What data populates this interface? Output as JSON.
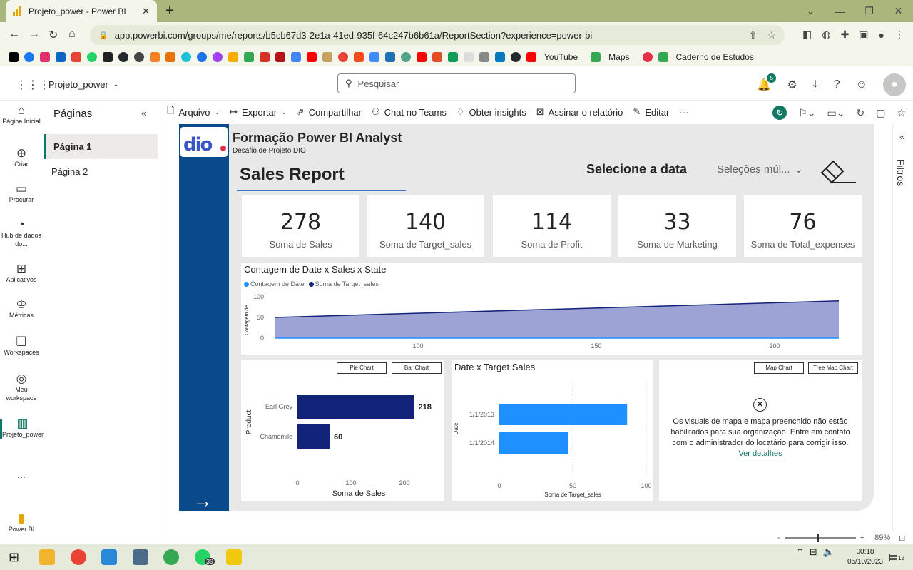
{
  "browser": {
    "tab_title": "Projeto_power - Power BI",
    "tab_close": "✕",
    "new_tab": "+",
    "url": "app.powerbi.com/groups/me/reports/b5cb67d3-2e1a-41ed-935f-64c247b6b61a/ReportSection?experience=power-bi",
    "bookmarks": [
      "YouTube",
      "Maps",
      "Caderno de Estudos"
    ]
  },
  "header": {
    "workspace": "Projeto_power",
    "search_placeholder": "Pesquisar",
    "notification_count": "5"
  },
  "rail": {
    "items": [
      "Página Inicial",
      "Criar",
      "Procurar",
      "Hub de dados do...",
      "Aplicativos",
      "Métricas",
      "Workspaces",
      "Meu workspace",
      "Projeto_power"
    ],
    "more": "...",
    "app_label": "Power BI"
  },
  "pages_pane": {
    "title": "Páginas",
    "pages": [
      "Página 1",
      "Página 2"
    ]
  },
  "toolbar": {
    "arquivo": "Arquivo",
    "exportar": "Exportar",
    "compartilhar": "Compartilhar",
    "chat": "Chat no Teams",
    "insights": "Obter insights",
    "assinar": "Assinar o relatório",
    "editar": "Editar",
    "more": "···"
  },
  "report": {
    "title": "Formação Power BI Analyst",
    "subtitle": "Desafio de Projeto DIO",
    "heading": "Sales Report",
    "date_label": "Selecione a data",
    "slicer_value": "Seleções múl...",
    "kpis": [
      {
        "value": "278",
        "label": "Soma de Sales"
      },
      {
        "value": "140",
        "label": "Soma de Target_sales"
      },
      {
        "value": "114",
        "label": "Soma de Profit"
      },
      {
        "value": "33",
        "label": "Soma de Marketing"
      },
      {
        "value": "76",
        "label": "Soma de Total_expenses"
      }
    ],
    "area_chart_title": "Contagem de Date x Sales x State",
    "buttons": {
      "pie": "Pie Chart",
      "bar": "Bar Chart",
      "map": "Map Chart",
      "treemap": "Tree Map Chart"
    },
    "date_target_title": "Date x Target Sales",
    "map_message": "Os visuais de mapa e mapa preenchido não estão habilitados para sua organização. Entre em contato com o administrador do locatário para corrigir isso.",
    "map_link": "Ver detalhes"
  },
  "filters": {
    "label": "Filtros"
  },
  "zoom": {
    "value": "89%"
  },
  "taskbar": {
    "time": "00:18",
    "date": "05/10/2023",
    "whatsapp_badge": "39",
    "notif_count": "12"
  },
  "colors": {
    "accent": "#117865",
    "dark_navy": "#12237a",
    "light_blue": "#1e90ff",
    "area_fill": "#9ea3d6",
    "report_blue": "#0a4a8a"
  },
  "chart_data": [
    {
      "type": "area",
      "title": "Contagem de Date x Sales x State",
      "legend": [
        "Contagem de Date",
        "Soma de Target_sales"
      ],
      "ylabel": "Contagem de ...",
      "xlim": [
        60,
        220
      ],
      "ylim": [
        0,
        100
      ],
      "x_ticks": [
        100,
        150,
        200
      ],
      "y_ticks": [
        0,
        50,
        100
      ],
      "series": [
        {
          "name": "Soma de Target_sales",
          "x": [
            60,
            218
          ],
          "y": [
            50,
            90
          ]
        },
        {
          "name": "Contagem de Date",
          "x": [
            60,
            218
          ],
          "y": [
            0,
            0
          ]
        }
      ]
    },
    {
      "type": "bar",
      "orientation": "horizontal",
      "categories": [
        "Earl Grey",
        "Chamomile"
      ],
      "values": [
        218,
        60
      ],
      "xlabel": "Soma de Sales",
      "ylabel": "Product",
      "xlim": [
        0,
        240
      ],
      "x_ticks": [
        0,
        100,
        200
      ]
    },
    {
      "type": "bar",
      "orientation": "horizontal",
      "title": "Date x Target Sales",
      "categories": [
        "1/1/2013",
        "1/1/2014"
      ],
      "values": [
        87,
        47
      ],
      "xlabel": "Soma de Target_sales",
      "ylabel": "Date",
      "xlim": [
        0,
        100
      ],
      "x_ticks": [
        0,
        50,
        100
      ]
    }
  ]
}
